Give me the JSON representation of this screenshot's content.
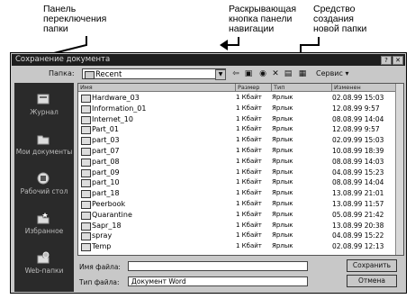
{
  "callouts": {
    "folder_bar": [
      "Панель",
      "переключения",
      "папки"
    ],
    "up_button": [
      "Раскрывающая",
      "кнопка панели",
      "навигации"
    ],
    "new_folder": [
      "Средство",
      "создания",
      "новой папки"
    ]
  },
  "window": {
    "title": "Сохранение документа",
    "buttons": [
      "?",
      "✕"
    ]
  },
  "lookin": {
    "label": "Папка:",
    "value": "Recent",
    "tools_label": "Сервис ▾"
  },
  "places": [
    {
      "label": "Журнал",
      "icon": "history-icon"
    },
    {
      "label": "Мои документы",
      "icon": "my-documents-icon"
    },
    {
      "label": "Рабочий стол",
      "icon": "desktop-icon"
    },
    {
      "label": "Избранное",
      "icon": "favorites-icon"
    },
    {
      "label": "Web-папки",
      "icon": "web-folders-icon"
    }
  ],
  "columns": [
    "Имя",
    "Размер",
    "Тип",
    "Изменен"
  ],
  "files": [
    {
      "name": "Hardware_03",
      "size": "1 Кбайт",
      "type": "Ярлык",
      "date": "02.08.99 15:03"
    },
    {
      "name": "Information_01",
      "size": "1 Кбайт",
      "type": "Ярлык",
      "date": "12.08.99 9:57"
    },
    {
      "name": "Internet_10",
      "size": "1 Кбайт",
      "type": "Ярлык",
      "date": "08.08.99 14:04"
    },
    {
      "name": "Part_01",
      "size": "1 Кбайт",
      "type": "Ярлык",
      "date": "12.08.99 9:57"
    },
    {
      "name": "part_03",
      "size": "1 Кбайт",
      "type": "Ярлык",
      "date": "02.09.99 15:03"
    },
    {
      "name": "part_07",
      "size": "1 Кбайт",
      "type": "Ярлык",
      "date": "10.08.99 18:39"
    },
    {
      "name": "part_08",
      "size": "1 Кбайт",
      "type": "Ярлык",
      "date": "08.08.99 14:03"
    },
    {
      "name": "part_09",
      "size": "1 Кбайт",
      "type": "Ярлык",
      "date": "04.08.99 15:23"
    },
    {
      "name": "part_10",
      "size": "1 Кбайт",
      "type": "Ярлык",
      "date": "08.08.99 14:04"
    },
    {
      "name": "part_18",
      "size": "1 Кбайт",
      "type": "Ярлык",
      "date": "13.08.99 21:01"
    },
    {
      "name": "Peerbook",
      "size": "1 Кбайт",
      "type": "Ярлык",
      "date": "13.08.99 11:57"
    },
    {
      "name": "Quarantine",
      "size": "1 Кбайт",
      "type": "Ярлык",
      "date": "05.08.99 21:42"
    },
    {
      "name": "Sapr_18",
      "size": "1 Кбайт",
      "type": "Ярлык",
      "date": "13.08.99 20:38"
    },
    {
      "name": "spray",
      "size": "1 Кбайт",
      "type": "Ярлык",
      "date": "04.08.99 15:22"
    },
    {
      "name": "Temp",
      "size": "1 Кбайт",
      "type": "Ярлык",
      "date": "02.08.99 12:13"
    }
  ],
  "bottom": {
    "filename_label": "Имя файла:",
    "filename_value": "",
    "filetype_label": "Тип файла:",
    "filetype_value": "Документ Word",
    "save_button": "Сохранить",
    "cancel_button": "Отмена"
  }
}
